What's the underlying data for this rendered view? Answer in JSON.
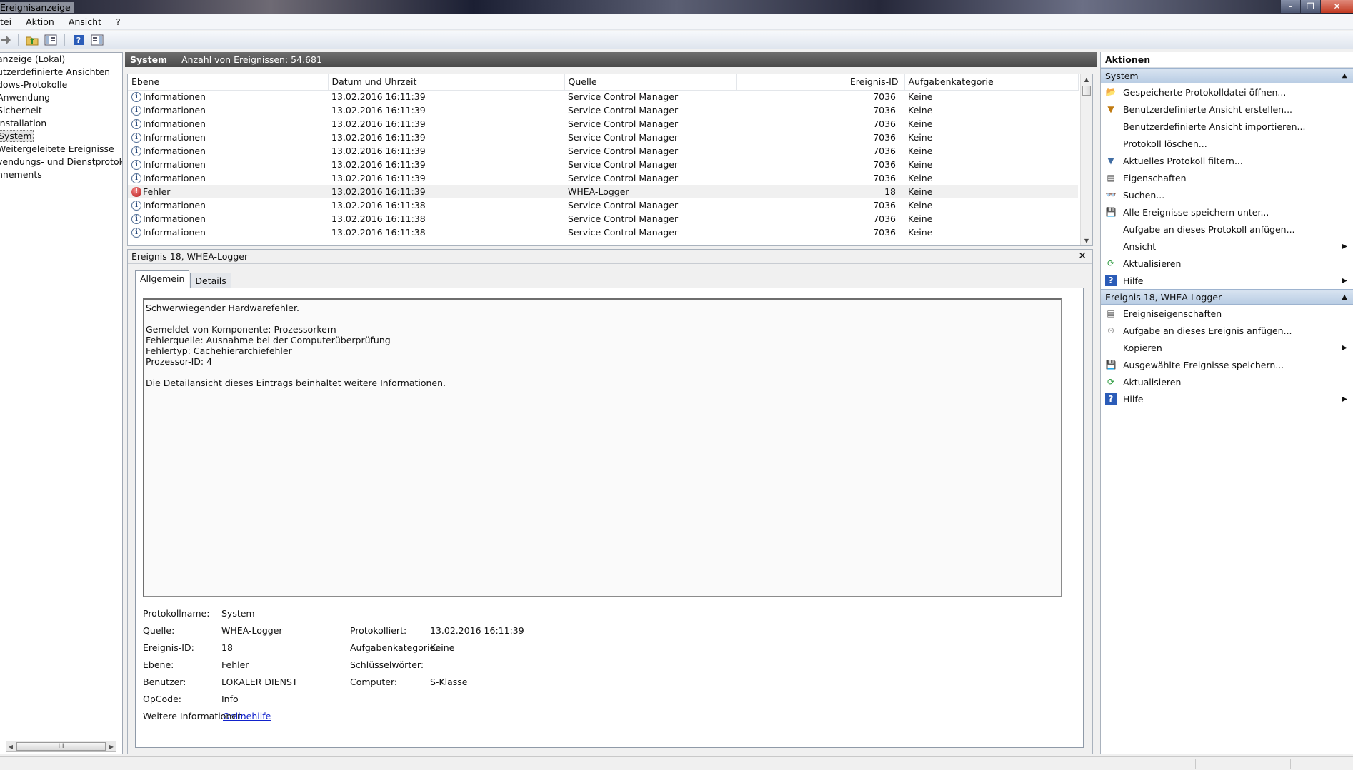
{
  "window": {
    "title": "Ereignisanzeige",
    "controls": {
      "minimize": "–",
      "maximize": "❐",
      "close": "✕"
    }
  },
  "menu": [
    "tei",
    "Aktion",
    "Ansicht",
    "?"
  ],
  "toolbar": {
    "icons": [
      "back-arrow-icon",
      "forward-arrow-icon",
      "up-folder-icon",
      "show-hide-tree-icon",
      "help-icon",
      "action-pane-icon"
    ]
  },
  "tree": {
    "items": [
      "anzeige (Lokal)",
      "utzerdefinierte Ansichten",
      "dows-Protokolle",
      "Anwendung",
      "Sicherheit",
      "Installation",
      "System",
      "Weitergeleitete Ereignisse",
      "vendungs- und Dienstprotokolle",
      "nnements"
    ],
    "selected_index": 6,
    "scroll_grip": "III"
  },
  "list": {
    "header_name": "System",
    "header_count": "Anzahl von Ereignissen: 54.681",
    "columns": [
      "Ebene",
      "Datum und Uhrzeit",
      "Quelle",
      "Ereignis-ID",
      "Aufgabenkategorie"
    ],
    "rows": [
      {
        "level": "Informationen",
        "type": "info",
        "date": "13.02.2016 16:11:39",
        "source": "Service Control Manager",
        "id": "7036",
        "category": "Keine"
      },
      {
        "level": "Informationen",
        "type": "info",
        "date": "13.02.2016 16:11:39",
        "source": "Service Control Manager",
        "id": "7036",
        "category": "Keine"
      },
      {
        "level": "Informationen",
        "type": "info",
        "date": "13.02.2016 16:11:39",
        "source": "Service Control Manager",
        "id": "7036",
        "category": "Keine"
      },
      {
        "level": "Informationen",
        "type": "info",
        "date": "13.02.2016 16:11:39",
        "source": "Service Control Manager",
        "id": "7036",
        "category": "Keine"
      },
      {
        "level": "Informationen",
        "type": "info",
        "date": "13.02.2016 16:11:39",
        "source": "Service Control Manager",
        "id": "7036",
        "category": "Keine"
      },
      {
        "level": "Informationen",
        "type": "info",
        "date": "13.02.2016 16:11:39",
        "source": "Service Control Manager",
        "id": "7036",
        "category": "Keine"
      },
      {
        "level": "Informationen",
        "type": "info",
        "date": "13.02.2016 16:11:39",
        "source": "Service Control Manager",
        "id": "7036",
        "category": "Keine"
      },
      {
        "level": "Fehler",
        "type": "error",
        "date": "13.02.2016 16:11:39",
        "source": "WHEA-Logger",
        "id": "18",
        "category": "Keine"
      },
      {
        "level": "Informationen",
        "type": "info",
        "date": "13.02.2016 16:11:38",
        "source": "Service Control Manager",
        "id": "7036",
        "category": "Keine"
      },
      {
        "level": "Informationen",
        "type": "info",
        "date": "13.02.2016 16:11:38",
        "source": "Service Control Manager",
        "id": "7036",
        "category": "Keine"
      },
      {
        "level": "Informationen",
        "type": "info",
        "date": "13.02.2016 16:11:38",
        "source": "Service Control Manager",
        "id": "7036",
        "category": "Keine"
      }
    ]
  },
  "detail": {
    "title": "Ereignis 18, WHEA-Logger",
    "tabs": [
      "Allgemein",
      "Details"
    ],
    "message_lines": [
      "Schwerwiegender Hardwarefehler.",
      "",
      "Gemeldet von Komponente: Prozessorkern",
      "Fehlerquelle: Ausnahme bei der Computerüberprüfung",
      "Fehlertyp: Cachehierarchiefehler",
      "Prozessor-ID: 4",
      "",
      "Die Detailansicht dieses Eintrags beinhaltet weitere Informationen."
    ],
    "props": {
      "protokollname_label": "Protokollname:",
      "protokollname": "System",
      "quelle_label": "Quelle:",
      "quelle": "WHEA-Logger",
      "protokolliert_label": "Protokolliert:",
      "protokolliert": "13.02.2016 16:11:39",
      "ereignisid_label": "Ereignis-ID:",
      "ereignisid": "18",
      "aufgabenkategorie_label": "Aufgabenkategorie:",
      "aufgabenkategorie": "Keine",
      "ebene_label": "Ebene:",
      "ebene": "Fehler",
      "schluesselwoerter_label": "Schlüsselwörter:",
      "schluesselwoerter": "",
      "benutzer_label": "Benutzer:",
      "benutzer": "LOKALER DIENST",
      "computer_label": "Computer:",
      "computer": "S-Klasse",
      "opcode_label": "OpCode:",
      "opcode": "Info",
      "weitere_label": "Weitere Informationen:",
      "weitere_link": "Onlinehilfe"
    }
  },
  "actions": {
    "title": "Aktionen",
    "section1": {
      "title": "System",
      "items": [
        {
          "label": "Gespeicherte Protokolldatei öffnen...",
          "icon": "open-log-icon",
          "submenu": false
        },
        {
          "label": "Benutzerdefinierte Ansicht erstellen...",
          "icon": "filter-create-icon",
          "submenu": false
        },
        {
          "label": "Benutzerdefinierte Ansicht importieren...",
          "icon": "",
          "submenu": false
        },
        {
          "label": "Protokoll löschen...",
          "icon": "",
          "submenu": false
        },
        {
          "label": "Aktuelles Protokoll filtern...",
          "icon": "filter-icon",
          "submenu": false
        },
        {
          "label": "Eigenschaften",
          "icon": "properties-icon",
          "submenu": false
        },
        {
          "label": "Suchen...",
          "icon": "find-icon",
          "submenu": false
        },
        {
          "label": "Alle Ereignisse speichern unter...",
          "icon": "save-icon",
          "submenu": false
        },
        {
          "label": "Aufgabe an dieses Protokoll anfügen...",
          "icon": "",
          "submenu": false
        },
        {
          "label": "Ansicht",
          "icon": "",
          "submenu": true
        },
        {
          "label": "Aktualisieren",
          "icon": "refresh-icon",
          "submenu": false
        },
        {
          "label": "Hilfe",
          "icon": "help-icon",
          "submenu": true
        }
      ]
    },
    "section2": {
      "title": "Ereignis 18, WHEA-Logger",
      "items": [
        {
          "label": "Ereigniseigenschaften",
          "icon": "event-properties-icon",
          "submenu": false
        },
        {
          "label": "Aufgabe an dieses Ereignis anfügen...",
          "icon": "attach-task-icon",
          "submenu": false
        },
        {
          "label": "Kopieren",
          "icon": "",
          "submenu": true
        },
        {
          "label": "Ausgewählte Ereignisse speichern...",
          "icon": "save-icon",
          "submenu": false
        },
        {
          "label": "Aktualisieren",
          "icon": "refresh-icon",
          "submenu": false
        },
        {
          "label": "Hilfe",
          "icon": "help-icon",
          "submenu": true
        }
      ]
    }
  }
}
